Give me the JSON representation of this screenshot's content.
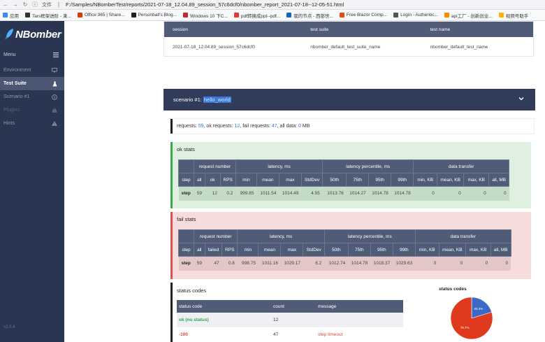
{
  "browser": {
    "url_prefix": "文件",
    "url": "F:/Samples/NBomberTest/reports/2021-07-18_12.04.89_session_57c6dcf0/nbomber_report_2021-07-18--12-05-51.html",
    "bookmarks": [
      {
        "label": "应用",
        "color": "#4285f4"
      },
      {
        "label": "Tars框架进阶 - 柬...",
        "color": "#333333"
      },
      {
        "label": "Office 365 | Share...",
        "color": "#d83b01"
      },
      {
        "label": "Personball's Blog...",
        "color": "#222222"
      },
      {
        "label": "Windows 10 下C...",
        "color": "#c62828"
      },
      {
        "label": "pdf转换成ppt--pdf...",
        "color": "#e53935"
      },
      {
        "label": "我的节点 - 西部世...",
        "color": "#1565c0"
      },
      {
        "label": "Free Blazor Comp...",
        "color": "#e64a19"
      },
      {
        "label": "Login - Authentic...",
        "color": "#555555"
      },
      {
        "label": "api工厂 - 创新创业...",
        "color": "#fb8c00"
      },
      {
        "label": "视频号助手",
        "color": "#ffb300"
      }
    ]
  },
  "sidebar": {
    "logo": "NBomber",
    "menu_label": "Menu",
    "items": [
      {
        "label": "Environment",
        "icon": "monitor-icon",
        "state": "normal"
      },
      {
        "label": "Test Suite",
        "icon": "flask-icon",
        "state": "active"
      },
      {
        "label": "Scenario #1",
        "icon": "info-circle-icon",
        "state": "normal"
      },
      {
        "label": "Plugins",
        "icon": "plugin-icon",
        "state": "dim"
      },
      {
        "label": "Hints",
        "icon": "warning-icon",
        "state": "normal"
      }
    ],
    "version": "v2.0.4"
  },
  "session": {
    "headers": [
      "session",
      "test suite",
      "test name"
    ],
    "values": [
      "2021-07-18_12.04.89_session_57c6dcf0",
      "nbomber_default_test_suite_name",
      "nbomber_default_test_name"
    ]
  },
  "scenario": {
    "label": "scenario #1:",
    "name": "hello_world"
  },
  "summary": {
    "requests_label": "requests:",
    "requests": "59",
    "ok_label": ", ok requests:",
    "ok": "12",
    "fail_label": ", fail requests:",
    "fail": "47",
    "data_label": ", all data:",
    "data": "0",
    "data_unit": "MB"
  },
  "ok_stats": {
    "title": "ok stats",
    "groups": [
      "request number",
      "latency, ms",
      "latency percentile, ms",
      "data transfer"
    ],
    "columns": [
      "step",
      "all",
      "ok",
      "RPS",
      "min",
      "mean",
      "max",
      "StdDev",
      "50th",
      "75th",
      "95th",
      "99th",
      "min, KB",
      "mean, KB",
      "max, KB",
      "all, MB"
    ],
    "row": [
      "step",
      "59",
      "12",
      "0.2",
      "999.85",
      "1011.54",
      "1014.49",
      "4.55",
      "1013.76",
      "1014.27",
      "1014.78",
      "1014.78",
      "0",
      "0",
      "0",
      "0"
    ]
  },
  "fail_stats": {
    "title": "fail stats",
    "groups": [
      "request number",
      "latency, ms",
      "latency percentile, ms",
      "data transfer"
    ],
    "columns": [
      "step",
      "all",
      "failed",
      "RPS",
      "min",
      "mean",
      "max",
      "StdDev",
      "50th",
      "75th",
      "95th",
      "99th",
      "min, KB",
      "mean, KB",
      "max, KB",
      "all, MB"
    ],
    "row": [
      "step",
      "59",
      "47",
      "0.8",
      "998.75",
      "1011.16",
      "1029.17",
      "6.2",
      "1012.74",
      "1014.78",
      "1018.37",
      "1029.63",
      "0",
      "0",
      "0",
      "0"
    ]
  },
  "status_codes": {
    "title": "status codes",
    "headers": [
      "status code",
      "count",
      "message"
    ],
    "rows": [
      {
        "code": "ok (no status)",
        "count": "12",
        "message": "",
        "kind": "ok"
      },
      {
        "code": "-100",
        "count": "47",
        "message": "step timeout",
        "kind": "bad"
      }
    ],
    "chart_title": "status codes"
  },
  "chart_data": {
    "type": "pie",
    "title": "status codes",
    "slices": [
      {
        "label": "20.3%",
        "value": 20.3,
        "color": "#3b69c8"
      },
      {
        "label": "79.7%",
        "value": 79.7,
        "color": "#e03a1e"
      }
    ]
  }
}
